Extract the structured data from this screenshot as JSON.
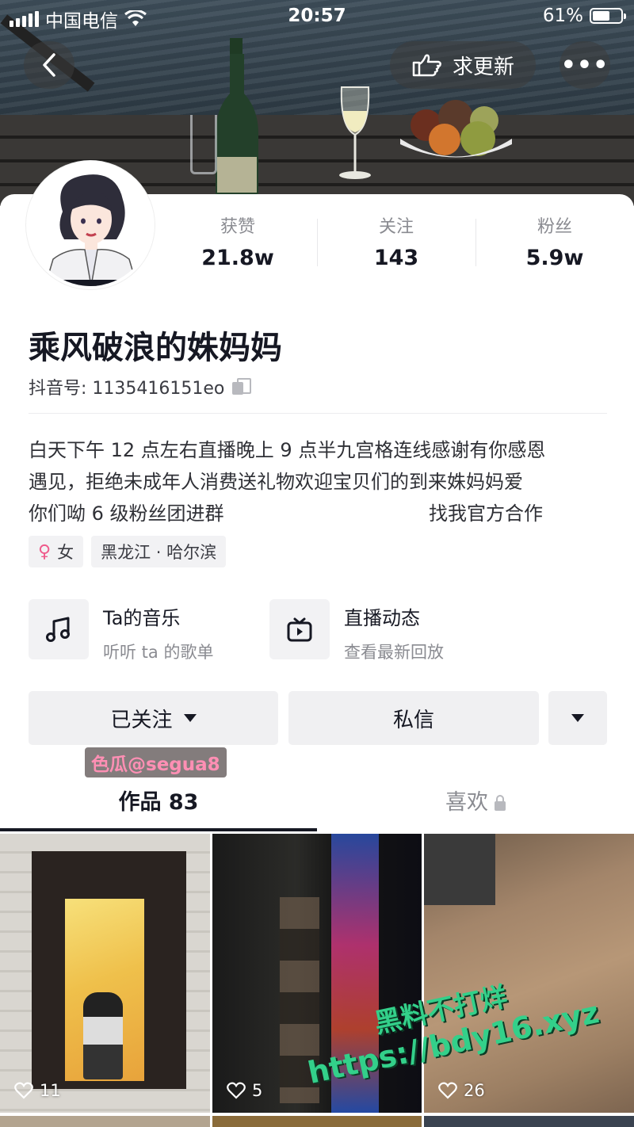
{
  "status_bar": {
    "carrier": "中国电信",
    "time": "20:57",
    "battery": "61%",
    "battery_level": 0.61
  },
  "nav": {
    "update_label": "求更新",
    "more_label": "•••"
  },
  "profile": {
    "stats": [
      {
        "label": "获赞",
        "value": "21.8w"
      },
      {
        "label": "关注",
        "value": "143"
      },
      {
        "label": "粉丝",
        "value": "5.9w"
      }
    ],
    "name": "乘风破浪的姝妈妈",
    "douyin_id": "抖音号: 1135416151eo",
    "bio_line1": "白天下午 12 点左右直播晚上 9 点半九宫格连线感谢有你感恩",
    "bio_line2": "遇见，拒绝未成年人消费送礼物欢迎宝贝们的到来姝妈妈爱",
    "bio_line3": "你们呦 6 级粉丝团进群",
    "bio_official": "找我官方合作",
    "tags": {
      "gender": "女",
      "location": "黑龙江 · 哈尔滨"
    }
  },
  "features": {
    "music": {
      "title": "Ta的音乐",
      "subtitle": "听听 ta 的歌单"
    },
    "live": {
      "title": "直播动态",
      "subtitle": "查看最新回放"
    }
  },
  "actions": {
    "followed_label": "已关注",
    "message_label": "私信"
  },
  "watermark_top": "色瓜@segua8",
  "tabs": {
    "works": "作品 83",
    "likes": "喜欢"
  },
  "videos": [
    {
      "likes": "11"
    },
    {
      "likes": "5"
    },
    {
      "likes": "26"
    }
  ],
  "watermark_overlay": {
    "line1": "黑料不打烊",
    "line2": "https://bdy16.xyz"
  },
  "colors": {
    "accent_pink": "#ef5a8b",
    "watermark_green": "#33d08a"
  }
}
